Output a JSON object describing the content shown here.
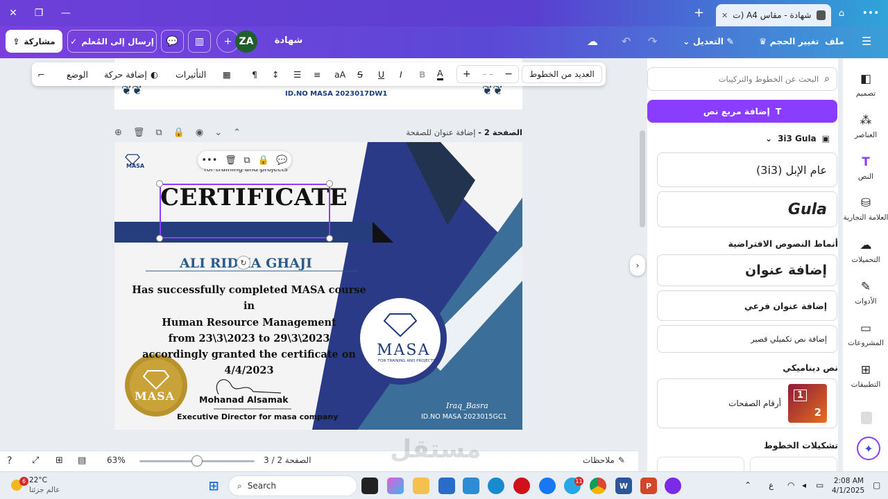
{
  "browser": {
    "tab_title": "شهادة - مقاس A4 (ت...",
    "new_tab": "+",
    "more": "•••"
  },
  "header": {
    "share_label": "مشاركة",
    "send_teacher_label": "إرسال إلى المُعلم",
    "avatar_initials": "ZA",
    "doc_title": "شهادة",
    "edit_label": "التعديل",
    "resize_label": "تغيير الحجم",
    "file_label": "ملف"
  },
  "text_toolbar": {
    "font_name": "العديد من الخطوط",
    "size_value": "– –",
    "effects_label": "التأثيرات",
    "animate_label": "إضافة حركة",
    "position_label": "الوضع",
    "case_label": "aA",
    "bold": "B",
    "italic": "I",
    "underline": "U",
    "strike": "S"
  },
  "page_bar": {
    "page_label": "الصفحة 2 -",
    "title_placeholder": "إضافة عنوان للصفحة"
  },
  "page1": {
    "id_text": "ID.NO MASA 2023017DW1"
  },
  "certificate": {
    "tagline": "for training and projects",
    "title": "CERTIFICATE",
    "name": "ALI RIDHA GHAJI",
    "body_lines": [
      "Has successfully completed MASA course in",
      "Human Resource Management",
      "from 23\\3\\2023 to 29\\3\\2023",
      "accordingly granted the certificate on",
      "4/4/2023"
    ],
    "signer_name": "Mohanad Alsamak",
    "signer_title": "Executive Director for masa company",
    "city": "Iraq_Basra",
    "id_no": "ID.NO MASA 2023015GC1",
    "logo_text": "MASA",
    "logo_sub": "FOR TRAINING AND PROJECTS",
    "seal_text": "MASA",
    "small_logo": "MASA"
  },
  "bottom_bar": {
    "notes_label": "ملاحظات",
    "page_counter": "الصفحة 2 / 3",
    "zoom": "63%",
    "zoom_fraction": 0.5
  },
  "side_panel": {
    "search_placeholder": "البحث عن الخطوط والتركيبات",
    "add_text_box": "إضافة مربع نص",
    "brand_kit_label": "3i3 Gula",
    "font_preview_1": "عام الإبل (3i3)",
    "font_preview_2": "Gula",
    "default_styles_title": "أنماط النصوص الافتراضية",
    "add_heading": "إضافة عنوان",
    "add_subheading": "إضافة عنوان فرعي",
    "add_body": "إضافة نص تكميلي قصير",
    "dynamic_title": "نص ديناميكي",
    "page_numbers": "أرقام الصفحات",
    "combos_title": "تشكيلات الخطوط"
  },
  "rail": {
    "design": "تصميم",
    "elements": "العناصر",
    "text": "النص",
    "brand": "العلامة التجارية",
    "uploads": "التحميلات",
    "tools": "الأدوات",
    "projects": "المشروعات",
    "apps": "التطبيقات"
  },
  "taskbar": {
    "temp": "22°C",
    "weather_desc": "عالم جزئتا",
    "weather_badge": "6",
    "search_label": "Search",
    "telegram_badge": "11",
    "time": "2:08 AM",
    "date": "4/1/2025",
    "lang": "ع"
  },
  "watermark": "مستقل"
}
